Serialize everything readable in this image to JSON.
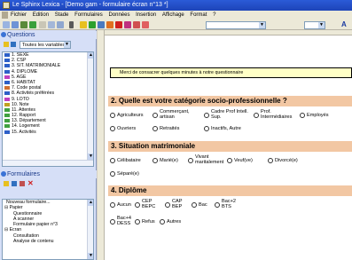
{
  "window": {
    "title": "Le Sphinx Lexica - [Demo gam - formulaire écran n°13 *]"
  },
  "menu": [
    "Fichier",
    "Edition",
    "Stade",
    "Formulaires",
    "Données",
    "Insertion",
    "Affichage",
    "Format",
    "?"
  ],
  "toolbar": {
    "font_select": "",
    "size_select": "",
    "font_letter": "A"
  },
  "questions_panel": {
    "title": "Questions",
    "filter": "Toutes les variables",
    "items": [
      "1. SEXE",
      "2. CSP",
      "3. SIT. MATRIMONIALE",
      "4. DIPLOME",
      "5. AGE",
      "6. HABITAT",
      "7. Code postal",
      "8. Activités préférées",
      "9. LOTO",
      "10. Note",
      "11. Attentes",
      "12. Rapport",
      "13. Département",
      "14. Logement",
      "15. Activités"
    ]
  },
  "forms_panel": {
    "title": "Formulaires",
    "items": [
      "Nouveau formulaire...",
      "Papier",
      "Questionnaire",
      "A scanner",
      "Formulaire papier n°3",
      "Ecran",
      "Consultation",
      "Analyse de contenu"
    ]
  },
  "form": {
    "intro": "Merci de consacrer quelques minutes à notre questionnaire",
    "q2": {
      "title": "2. Quelle est votre catégorie socio-professionnelle ?",
      "row1": [
        "Agriculteurs",
        "Commerçant,\nartisan",
        "Cadre Prof Intell.\nSup.",
        "Prof.\nIntermédiaires",
        "Employés"
      ],
      "row2": [
        "Ouvriers",
        "Retraités",
        "Inactifs, Autre"
      ]
    },
    "q3": {
      "title": "3. Situation matrimoniale",
      "row1": [
        "Célibataire",
        "Marié(e)",
        "Vivant\nmaritalement",
        "Veuf(ve)",
        "Divorcé(e)"
      ],
      "row2": [
        "Séparé(e)"
      ]
    },
    "q4": {
      "title": "4. Diplôme",
      "row1": [
        "Aucun",
        "CEP\nBEPC",
        "CAP\nBEP",
        "Bac",
        "Bac+2\nBTS"
      ],
      "row2": [
        "Bac+4\nDESS",
        "Refus",
        "Autres"
      ]
    }
  }
}
